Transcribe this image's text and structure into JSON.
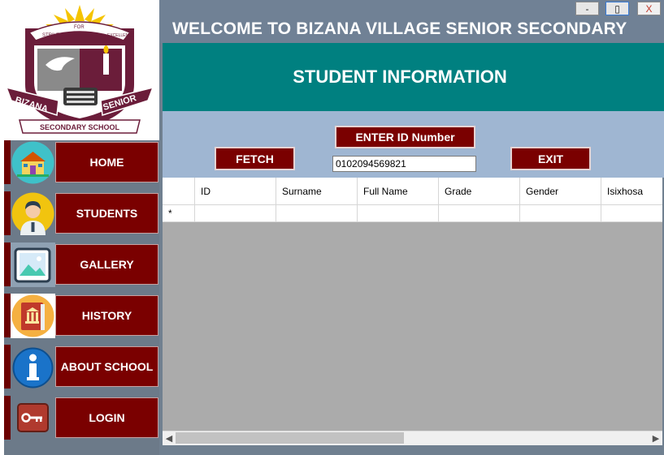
{
  "window": {
    "minimize_label": "-",
    "maximize_label": "▯",
    "close_label": "X"
  },
  "header": {
    "welcome": "WELCOME TO BIZANA VILLAGE SENIOR SECONDARY",
    "title": "STUDENT INFORMATION"
  },
  "logo": {
    "ribbon_left": "STRIVE",
    "ribbon_center": "FOR",
    "ribbon_right": "EXCELLENCE",
    "banner_left": "BIZANA",
    "banner_right": "SENIOR",
    "bottom": "SECONDARY SCHOOL"
  },
  "sidebar": {
    "items": [
      {
        "label": "HOME",
        "icon": "school-icon"
      },
      {
        "label": "STUDENTS",
        "icon": "student-icon"
      },
      {
        "label": "GALLERY",
        "icon": "picture-icon"
      },
      {
        "label": "HISTORY",
        "icon": "history-book-icon"
      },
      {
        "label": "ABOUT SCHOOL",
        "icon": "info-icon"
      },
      {
        "label": "LOGIN",
        "icon": "key-icon"
      }
    ]
  },
  "controls": {
    "enter_id_label": "ENTER ID Number",
    "fetch_label": "FETCH",
    "exit_label": "EXIT",
    "id_value": "0102094569821"
  },
  "grid": {
    "columns": [
      "ID",
      "Surname",
      "Full Name",
      "Grade",
      "Gender",
      "Isixhosa"
    ],
    "new_row_marker": "*"
  },
  "colors": {
    "accent_red": "#7a0000",
    "teal_header": "#008080",
    "control_band": "#9fb6d2",
    "background": "#708090"
  }
}
